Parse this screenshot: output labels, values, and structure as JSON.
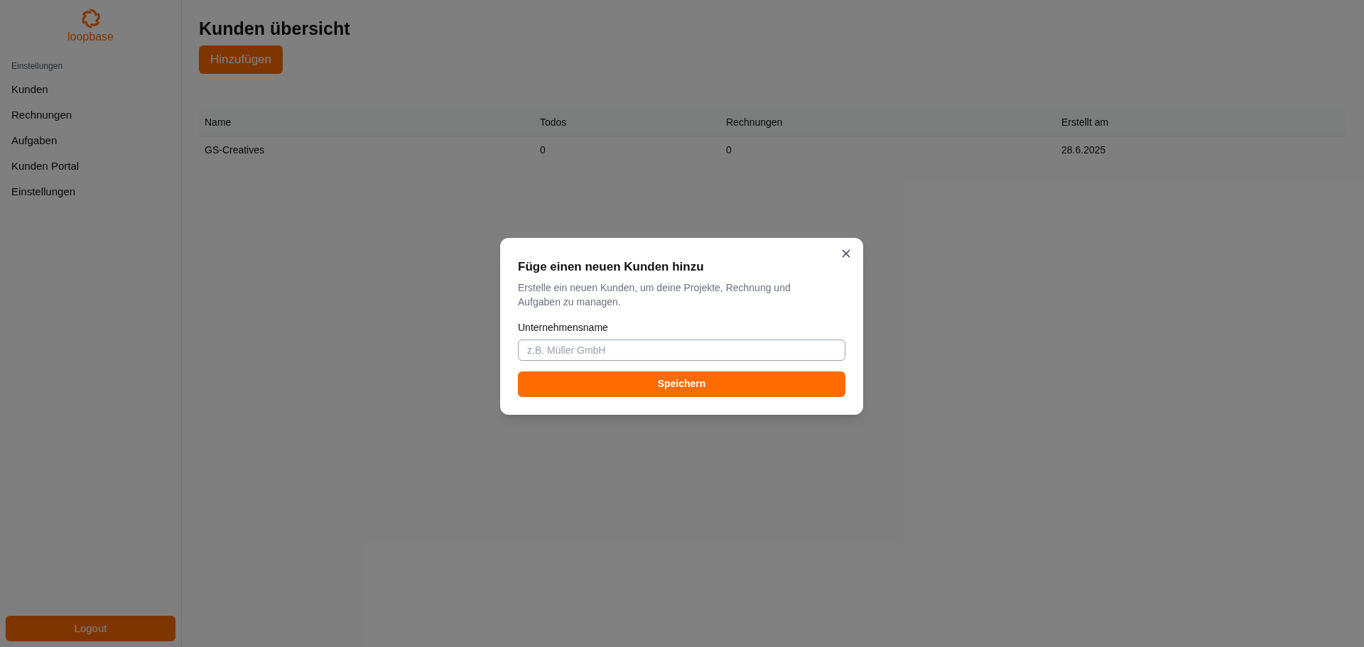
{
  "sidebar": {
    "logo_text": "loopbase",
    "section_label": "Einstellungen",
    "items": [
      {
        "label": "Kunden"
      },
      {
        "label": "Rechnungen"
      },
      {
        "label": "Aufgaben"
      },
      {
        "label": "Kunden Portal"
      },
      {
        "label": "Einstellungen"
      }
    ],
    "logout": "Logout"
  },
  "page": {
    "title": "Kunden übersicht",
    "add_button": "Hinzufügen"
  },
  "table": {
    "columns": [
      "Name",
      "Todos",
      "Rechnungen",
      "Erstellt am"
    ],
    "rows": [
      [
        "GS-Creatives",
        "0",
        "0",
        "28.6.2025"
      ]
    ]
  },
  "dialog": {
    "title": "Füge einen neuen Kunden hinzu",
    "description": "Erstelle ein neuen Kunden, um deine Projekte, Rechnung und Aufgaben zu managen.",
    "field_label": "Unternehmensname",
    "placeholder": "z.B. Müller GmbH",
    "save_button": "Speichern"
  }
}
